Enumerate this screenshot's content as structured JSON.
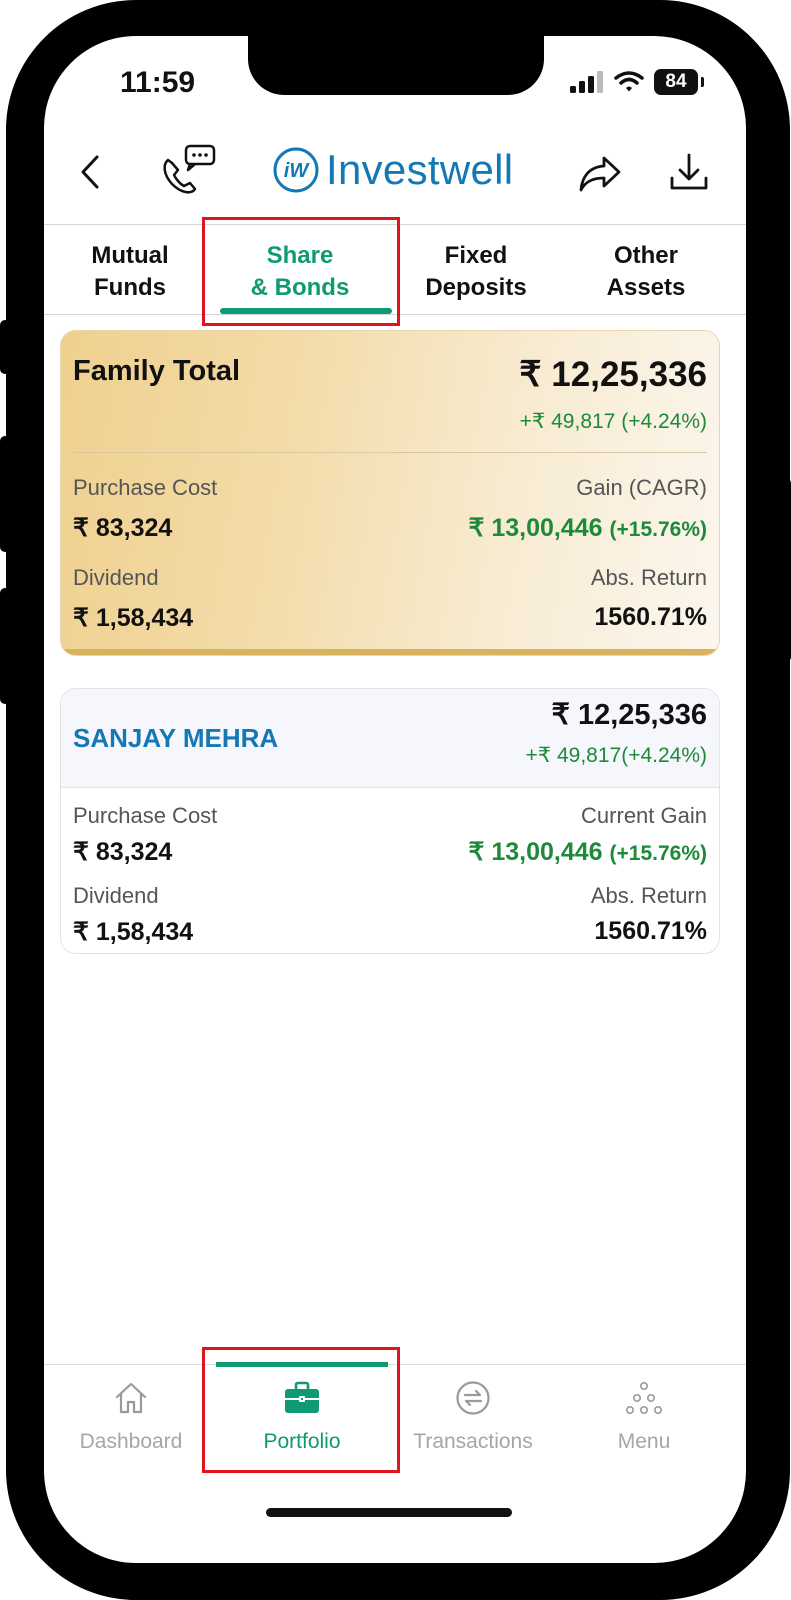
{
  "status_bar": {
    "time": "11:59",
    "battery": "84"
  },
  "header": {
    "logo_text": "Investwell",
    "logo_monogram": "iW"
  },
  "tabs": [
    {
      "line1": "Mutual",
      "line2": "Funds"
    },
    {
      "line1": "Share",
      "line2": "& Bonds"
    },
    {
      "line1": "Fixed",
      "line2": "Deposits"
    },
    {
      "line1": "Other",
      "line2": "Assets"
    }
  ],
  "active_tab": "Share & Bonds",
  "family_total": {
    "title": "Family Total",
    "value": "₹ 12,25,336",
    "change": "+₹ 49,817 (+4.24%)",
    "purchase_cost_label": "Purchase Cost",
    "purchase_cost": "₹ 83,324",
    "gain_label": "Gain (CAGR)",
    "gain_value": "₹ 13,00,446",
    "gain_pct": "(+15.76%)",
    "dividend_label": "Dividend",
    "dividend": "₹ 1,58,434",
    "abs_return_label": "Abs. Return",
    "abs_return": "1560.71%"
  },
  "members": [
    {
      "name": "SANJAY MEHRA",
      "value": "₹ 12,25,336",
      "change": "+₹ 49,817(+4.24%)",
      "purchase_cost_label": "Purchase Cost",
      "purchase_cost": "₹ 83,324",
      "gain_label": "Current Gain",
      "gain_value": "₹ 13,00,446",
      "gain_pct": "(+15.76%)",
      "dividend_label": "Dividend",
      "dividend": "₹ 1,58,434",
      "abs_return_label": "Abs. Return",
      "abs_return": "1560.71%"
    }
  ],
  "bottom_nav": [
    {
      "label": "Dashboard",
      "icon": "home-icon"
    },
    {
      "label": "Portfolio",
      "icon": "briefcase-icon"
    },
    {
      "label": "Transactions",
      "icon": "exchange-icon"
    },
    {
      "label": "Menu",
      "icon": "dots-menu-icon"
    }
  ],
  "active_nav": "Portfolio",
  "colors": {
    "accent": "#0f9a74",
    "brand_blue": "#1478b4",
    "gain_green": "#1d8a3a",
    "highlight_red": "#e0141e",
    "card_gold": "#efd08e"
  }
}
